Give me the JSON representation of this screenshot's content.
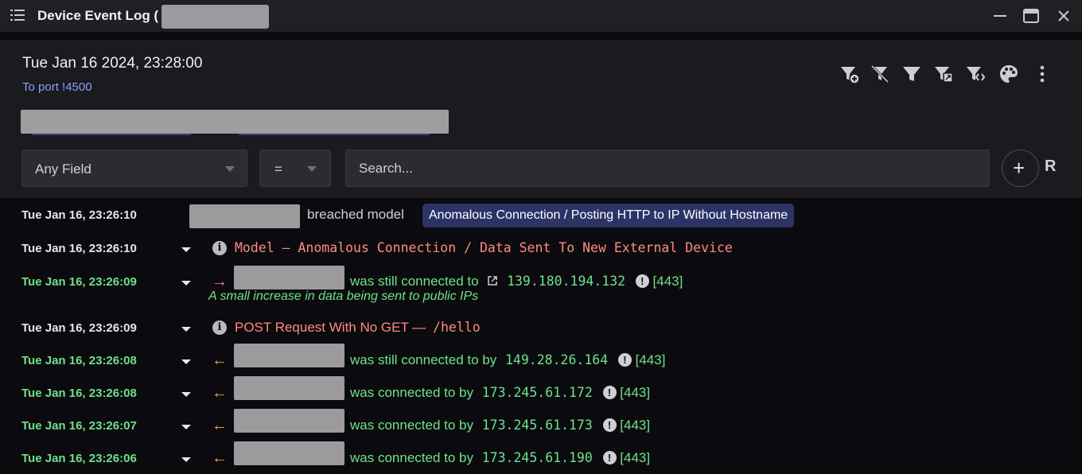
{
  "window": {
    "title": "Device Event Log (",
    "minimize_label": "—",
    "close_label": "✕"
  },
  "header": {
    "datetime": "Tue Jan 16 2024, 23:28:00",
    "port_link": "To port !4500",
    "toolbar_icons": [
      "filter-add-icon",
      "filter-clear-icon",
      "filter-icon",
      "filter-export-icon",
      "filter-code-icon",
      "palette-icon",
      "more-vert-icon"
    ]
  },
  "filter": {
    "field_value": "Any Field",
    "operator_value": "=",
    "search_placeholder": "Search...",
    "add_label": "+",
    "reset_label": "R"
  },
  "log": [
    {
      "time": "Tue Jan 16, 23:26:10",
      "kind": "breach",
      "text": "breached model",
      "model": "Anomalous Connection / Posting HTTP to IP Without Hostname"
    },
    {
      "time": "Tue Jan 16, 23:26:10",
      "kind": "model",
      "text": "Model — Anomalous Connection / Data Sent To New External Device"
    },
    {
      "time": "Tue Jan 16, 23:26:09",
      "kind": "out",
      "text": "was still connected to",
      "ip": "139.180.194.132",
      "port": "[443]",
      "note": "A small increase in data being sent to public IPs"
    },
    {
      "time": "Tue Jan 16, 23:26:09",
      "kind": "post",
      "text": "POST Request With No GET —",
      "path": "/hello"
    },
    {
      "time": "Tue Jan 16, 23:26:08",
      "kind": "in",
      "text": "was still connected to by",
      "ip": "149.28.26.164",
      "port": "[443]"
    },
    {
      "time": "Tue Jan 16, 23:26:08",
      "kind": "in",
      "text": "was connected to by",
      "ip": "173.245.61.172",
      "port": "[443]"
    },
    {
      "time": "Tue Jan 16, 23:26:07",
      "kind": "in",
      "text": "was connected to by",
      "ip": "173.245.61.173",
      "port": "[443]"
    },
    {
      "time": "Tue Jan 16, 23:26:06",
      "kind": "in",
      "text": "was connected to by",
      "ip": "173.245.61.190",
      "port": "[443]"
    }
  ]
}
